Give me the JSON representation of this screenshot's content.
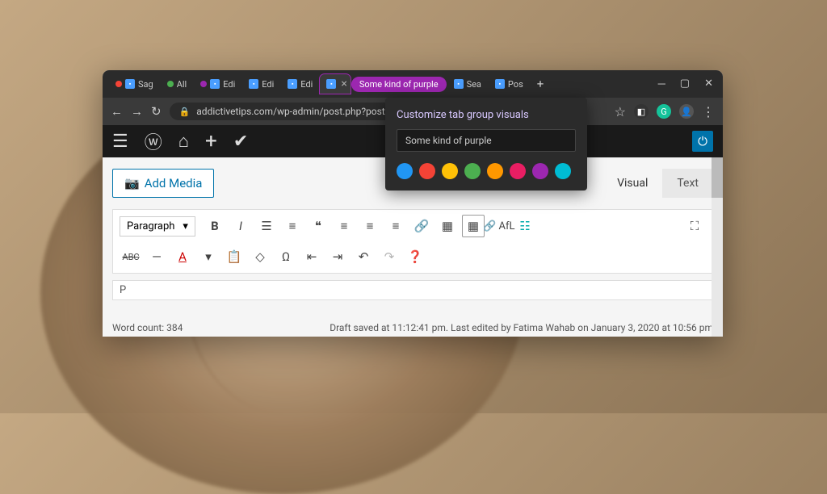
{
  "tabs": [
    {
      "label": "Sag",
      "dot": "#f44336"
    },
    {
      "label": "All",
      "dot": "#4caf50"
    },
    {
      "label": "Edi",
      "dot": "#9c27b0"
    },
    {
      "label": "Edi"
    },
    {
      "label": "Edi"
    },
    {
      "label": ""
    }
  ],
  "group_pill": "Some kind of purple",
  "extra_tabs": [
    {
      "label": "Sea"
    },
    {
      "label": "Pos"
    }
  ],
  "url": "addictivetips.com/wp-admin/post.php?post=",
  "popup": {
    "title": "Customize tab group visuals",
    "input_value": "Some kind of purple",
    "colors": [
      "#2196f3",
      "#f44336",
      "#ffc107",
      "#4caf50",
      "#ff9800",
      "#e91e63",
      "#9c27b0",
      "#00bcd4"
    ]
  },
  "add_media": "Add Media",
  "editor_tabs": {
    "visual": "Visual",
    "text": "Text"
  },
  "format_select": "Paragraph",
  "afl": "AfL",
  "path": "P",
  "status": {
    "wordcount": "Word count: 384",
    "draft": "Draft saved at 11:12:41 pm. Last edited by Fatima Wahab on January 3, 2020 at 10:56 pm"
  }
}
